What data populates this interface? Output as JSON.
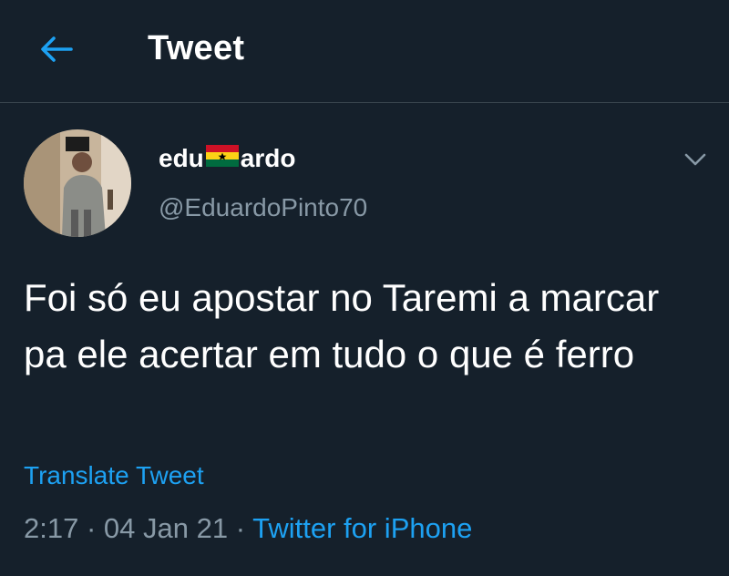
{
  "colors": {
    "background": "#15202b",
    "accent": "#1da1f2",
    "secondary_text": "#8899a6",
    "divider": "#38444d"
  },
  "header": {
    "title": "Tweet",
    "back_icon": "arrow-left-icon"
  },
  "tweet": {
    "author": {
      "name_prefix": "edu",
      "name_emoji": "ghana-flag-emoji",
      "name_suffix": "ardo",
      "handle": "@EduardoPinto70"
    },
    "text": "Foi só eu apostar no Taremi a marcar pa ele acertar em tudo o que é ferro",
    "translate_label": "Translate Tweet",
    "time": "2:17",
    "separator": "·",
    "date": "04 Jan 21",
    "source": "Twitter for iPhone",
    "menu_icon": "chevron-down-icon"
  }
}
